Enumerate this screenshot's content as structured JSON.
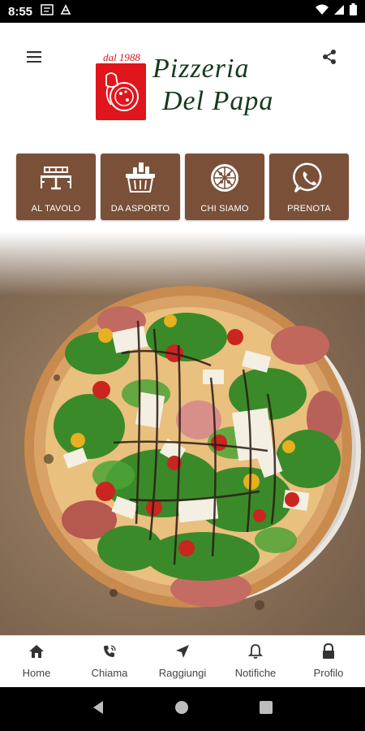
{
  "status_bar": {
    "time": "8:55",
    "left_icons": [
      "notification-icon",
      "vpn-icon"
    ],
    "right_icons": [
      "wifi-icon",
      "signal-icon",
      "battery-icon"
    ]
  },
  "header": {
    "menu_icon": "hamburger-menu-icon",
    "share_icon": "share-icon",
    "logo": {
      "year_text": "dal 1988",
      "name_line1": "Pizzeria",
      "name_line2": "Del Papa"
    }
  },
  "tiles": [
    {
      "label": "AL TAVOLO",
      "icon": "table-icon"
    },
    {
      "label": "DA ASPORTO",
      "icon": "basket-icon"
    },
    {
      "label": "CHI SIAMO",
      "icon": "pizza-icon"
    },
    {
      "label": "PRENOTA",
      "icon": "whatsapp-icon"
    }
  ],
  "hero": {
    "image": "pizza-photo"
  },
  "bottom_nav": [
    {
      "label": "Home",
      "icon": "home-icon"
    },
    {
      "label": "Chiama",
      "icon": "phone-icon"
    },
    {
      "label": "Raggiungi",
      "icon": "navigation-arrow-icon"
    },
    {
      "label": "Notifiche",
      "icon": "bell-icon"
    },
    {
      "label": "Profilo",
      "icon": "lock-icon"
    }
  ],
  "colors": {
    "tile_background": "#7a5039",
    "logo_red": "#e0161c",
    "logo_green": "#163a1c"
  }
}
